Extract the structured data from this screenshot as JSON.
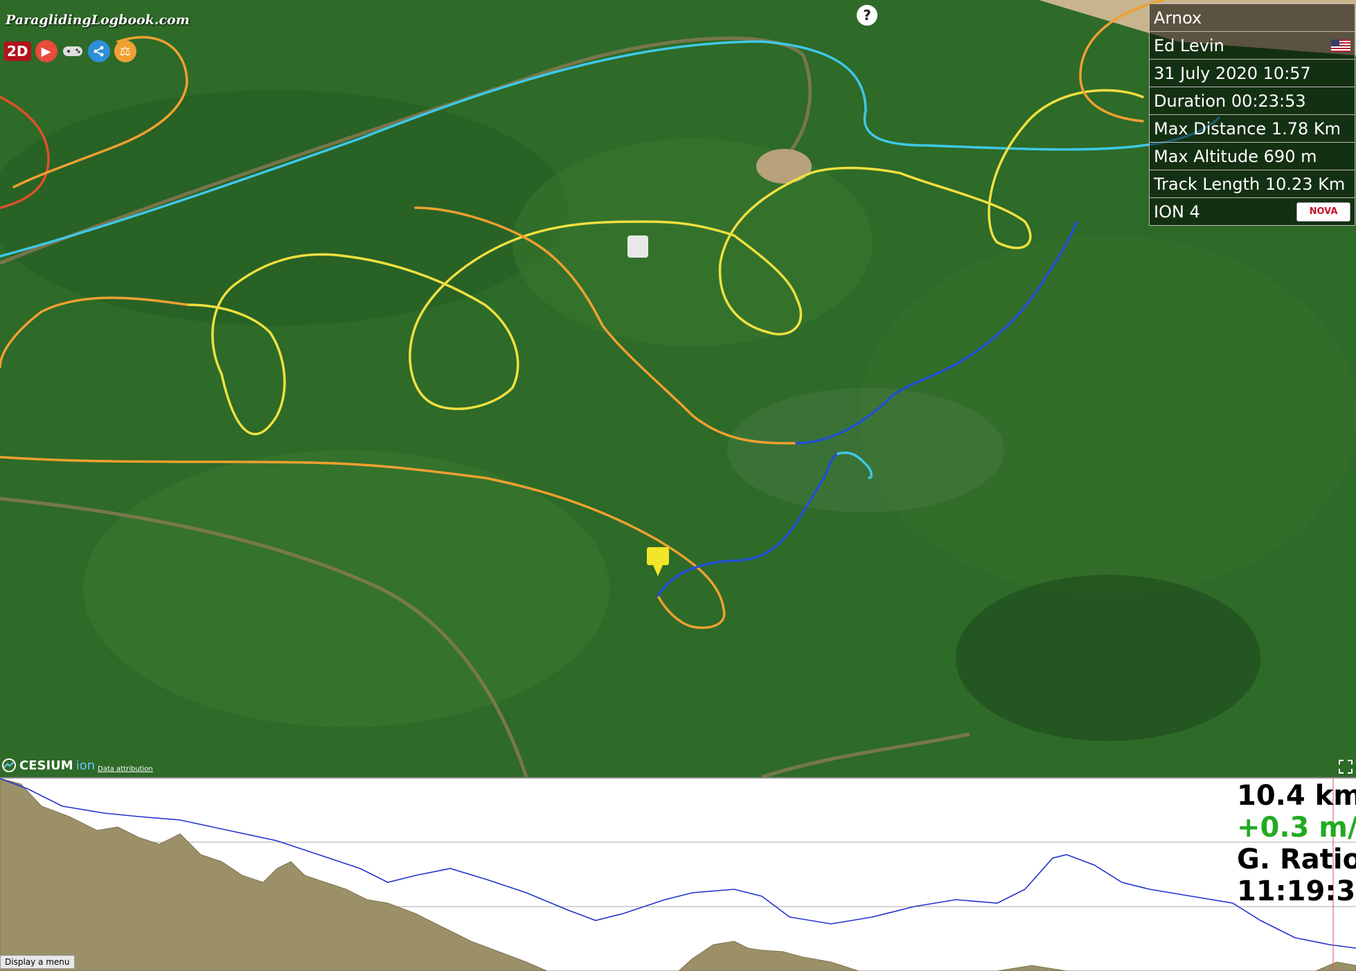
{
  "app": {
    "logo_text": "ParaglidingLogbook.com"
  },
  "toolbar": {
    "mode_label": "2D"
  },
  "help": {
    "label": "?"
  },
  "info_panel": {
    "pilot": "Arnox",
    "site": "Ed Levin",
    "date": "31 July 2020 10:57",
    "duration": "Duration 00:23:53",
    "max_distance": "Max Distance 1.78 Km",
    "max_altitude": "Max Altitude 690 m",
    "track_length": "Track Length 10.23 Km",
    "glider": "ION 4",
    "glider_brand": "NOVA"
  },
  "map_footer": {
    "provider": "CESIUM",
    "provider_suffix": "ion",
    "attribution": "Data attribution"
  },
  "readout": {
    "distance": "10.4 km",
    "vario": "+0.3 m/",
    "ratio": "G. Ratio",
    "time": "11:19:3"
  },
  "menu": {
    "label": "Display a menu"
  },
  "colors": {
    "track_high": "#f0e040",
    "track_mid": "#f0a030",
    "track_low": "#3fc8e8",
    "track_sink": "#2050d0",
    "terrain_fill": "#9c9068",
    "altitude_line": "#2233cc"
  }
}
